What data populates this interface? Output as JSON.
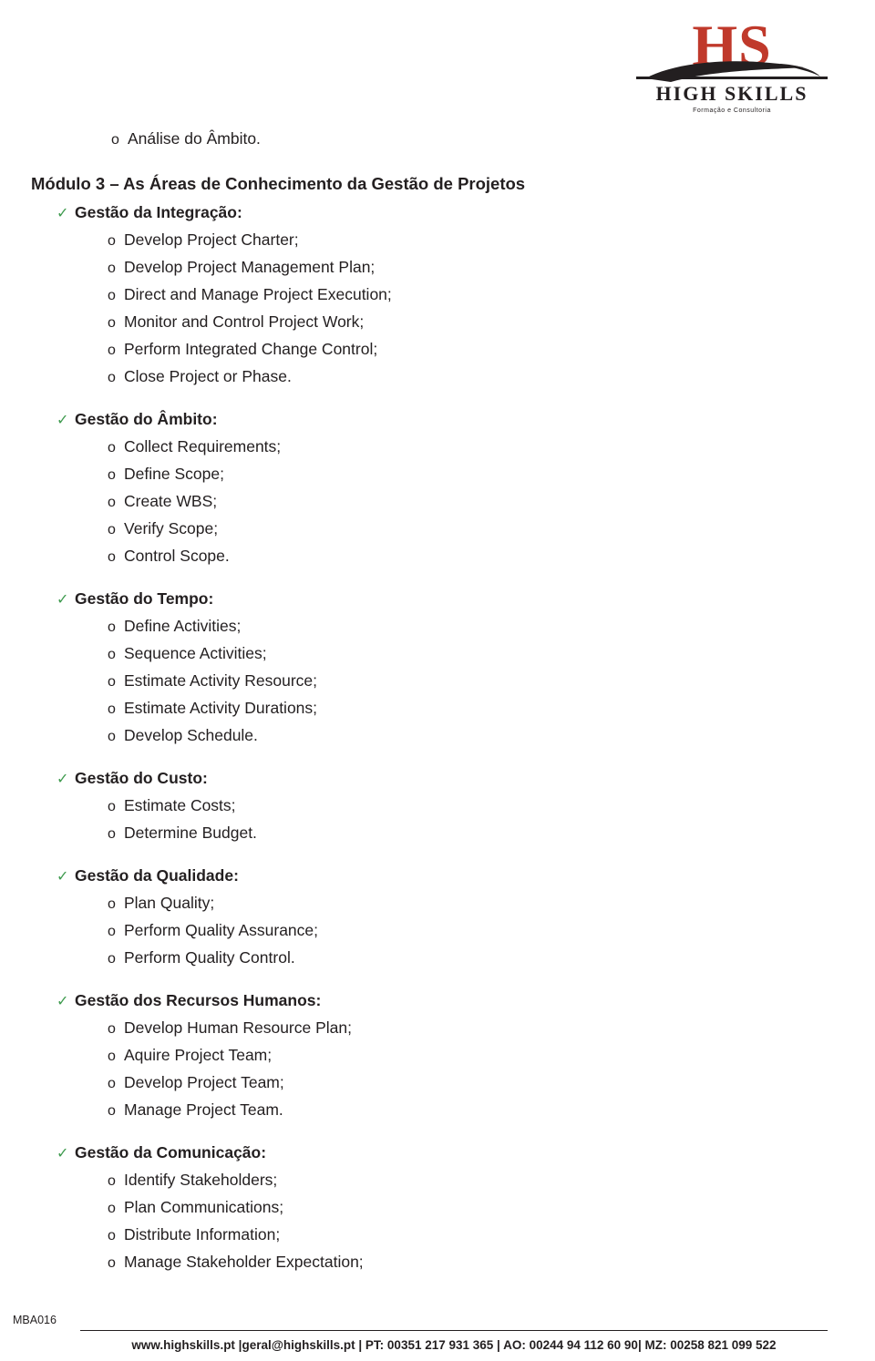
{
  "logo": {
    "mark": "HS",
    "name": "HIGH SKILLS",
    "tagline": "Formação e Consultoria"
  },
  "body": {
    "pre_item": "Análise do Âmbito.",
    "heading": "Módulo 3 – As Áreas de Conhecimento da Gestão de Projetos",
    "groups": [
      {
        "label": "Gestão da Integração:",
        "items": [
          "Develop Project Charter;",
          "Develop Project Management Plan;",
          "Direct and Manage Project Execution;",
          "Monitor and Control Project Work;",
          "Perform Integrated Change Control;",
          "Close Project or Phase."
        ]
      },
      {
        "label": "Gestão do Âmbito:",
        "items": [
          "Collect Requirements;",
          "Define Scope;",
          "Create WBS;",
          "Verify Scope;",
          "Control Scope."
        ]
      },
      {
        "label": "Gestão do Tempo:",
        "items": [
          "Define Activities;",
          "Sequence Activities;",
          "Estimate Activity Resource;",
          "Estimate Activity Durations;",
          "Develop Schedule."
        ]
      },
      {
        "label": "Gestão do Custo:",
        "items": [
          "Estimate Costs;",
          "Determine Budget."
        ]
      },
      {
        "label": "Gestão da Qualidade:",
        "items": [
          "Plan Quality;",
          "Perform Quality Assurance;",
          "Perform Quality Control."
        ]
      },
      {
        "label": "Gestão dos Recursos Humanos:",
        "items": [
          "Develop Human Resource Plan;",
          "Aquire Project Team;",
          "Develop Project Team;",
          "Manage Project Team."
        ]
      },
      {
        "label": "Gestão da Comunicação:",
        "items": [
          "Identify Stakeholders;",
          "Plan Communications;",
          "Distribute Information;",
          "Manage Stakeholder Expectation;"
        ]
      }
    ]
  },
  "footer": {
    "code": "MBA016",
    "text": "www.highskills.pt |geral@highskills.pt | PT: 00351 217 931 365 | AO: 00244 94 112 60 90| MZ: 00258 821 099 522"
  },
  "glyphs": {
    "circle_bullet": "o",
    "check_bullet": "✓"
  },
  "colors": {
    "logo_red": "#c0392b",
    "check_green": "#3f9b4f",
    "text": "#231f20"
  }
}
